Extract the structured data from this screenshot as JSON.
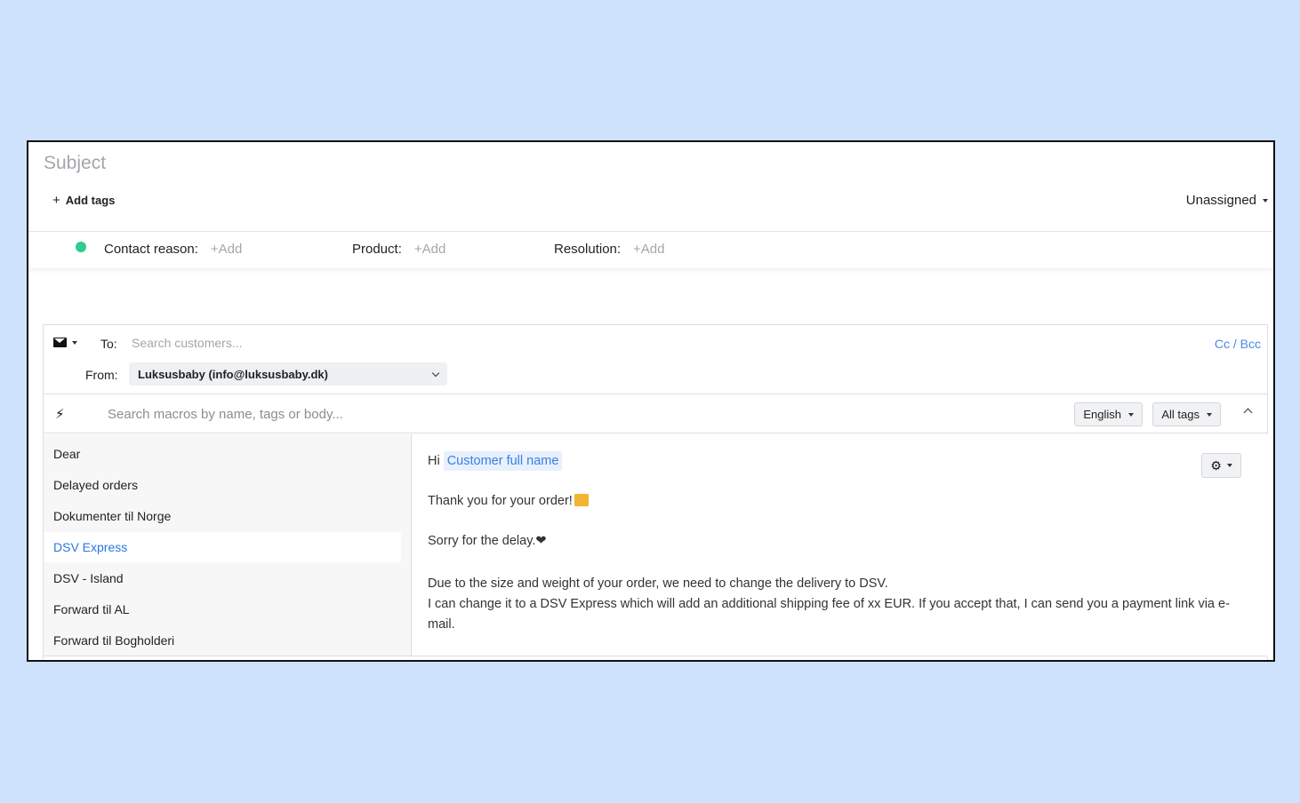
{
  "header": {
    "subject_placeholder": "Subject",
    "add_tags_label": "Add tags",
    "assignee": "Unassigned"
  },
  "fields": [
    {
      "label": "Contact reason:",
      "value": "+Add"
    },
    {
      "label": "Product:",
      "value": "+Add"
    },
    {
      "label": "Resolution:",
      "value": "+Add"
    }
  ],
  "status_color": "#2ecc8f",
  "composer": {
    "channel_icon": "envelope-icon",
    "to_label": "To:",
    "to_placeholder": "Search customers...",
    "cc_bcc": "Cc / Bcc",
    "from_label": "From:",
    "from_value": "Luksusbaby (info@luksusbaby.dk)"
  },
  "macros": {
    "search_placeholder": "Search macros by name, tags or body...",
    "language": "English",
    "tags_filter": "All tags",
    "items": [
      {
        "label": "Dear",
        "active": false
      },
      {
        "label": "Delayed orders",
        "active": false
      },
      {
        "label": "Dokumenter til Norge",
        "active": false
      },
      {
        "label": "DSV Express",
        "active": true
      },
      {
        "label": "DSV - Island",
        "active": false
      },
      {
        "label": "Forward til AL",
        "active": false
      },
      {
        "label": "Forward til Bogholderi",
        "active": false
      }
    ]
  },
  "preview": {
    "greeting": "Hi",
    "variable": "Customer full name",
    "line1": "Thank you for your order!",
    "line2": "Sorry for the delay.❤",
    "line3": "Due to the size and weight of your order, we need to change the delivery to DSV.",
    "line4": "I can change it to a DSV Express which will add an additional shipping fee of xx EUR. If you accept that, I can send you a payment link via e-mail."
  },
  "colors": {
    "background": "#cfe2fd",
    "accent": "#2a77e0",
    "link": "#4a86e8"
  }
}
